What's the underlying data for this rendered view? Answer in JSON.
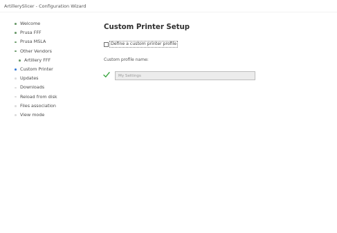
{
  "window": {
    "title": "ArtillerySlicer - Configuration Wizard"
  },
  "sidebar": {
    "items": [
      {
        "label": "Welcome",
        "state": "done",
        "indent": 0
      },
      {
        "label": "Prusa FFF",
        "state": "done",
        "indent": 0
      },
      {
        "label": "Prusa MSLA",
        "state": "done",
        "indent": 0
      },
      {
        "label": "Other Vendors",
        "state": "done",
        "indent": 0
      },
      {
        "label": "Artillery FFF",
        "state": "done",
        "indent": 1
      },
      {
        "label": "Custom Printer",
        "state": "active",
        "indent": 0
      },
      {
        "label": "Updates",
        "state": "todo",
        "indent": 0
      },
      {
        "label": "Downloads",
        "state": "todo",
        "indent": 0
      },
      {
        "label": "Reload from disk",
        "state": "todo",
        "indent": 0
      },
      {
        "label": "Files association",
        "state": "todo",
        "indent": 0
      },
      {
        "label": "View mode",
        "state": "todo",
        "indent": 0
      }
    ]
  },
  "main": {
    "title": "Custom Printer Setup",
    "define_checkbox": {
      "label": "Define a custom printer profile",
      "checked": false
    },
    "profile_name_label": "Custom profile name:",
    "profile_name_input": {
      "value": "",
      "placeholder": "My Settings"
    },
    "check_icon": "checkmark-icon"
  },
  "colors": {
    "done": "#6a9a6a",
    "active": "#3b7dd8",
    "todo": "#dcdcdc",
    "check": "#3aa640"
  }
}
